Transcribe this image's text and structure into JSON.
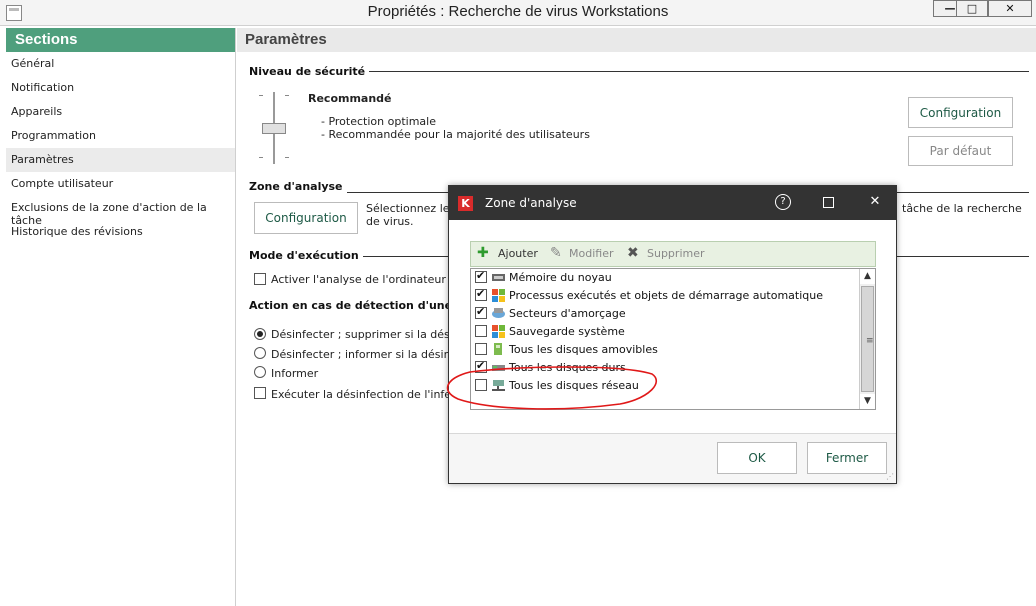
{
  "window": {
    "title": "Propriétés : Recherche de virus Workstations"
  },
  "window_controls": {
    "minimize": "—",
    "maximize": "□",
    "close": "✕"
  },
  "sidebar": {
    "title": "Sections",
    "items": [
      {
        "label": "Général"
      },
      {
        "label": "Notification"
      },
      {
        "label": "Appareils"
      },
      {
        "label": "Programmation"
      },
      {
        "label": "Paramètres",
        "active": true
      },
      {
        "label": "Compte utilisateur"
      },
      {
        "label": "Exclusions de la zone d'action de la tâche"
      },
      {
        "label": "Historique des révisions"
      }
    ]
  },
  "main": {
    "title": "Paramètres",
    "security_level": {
      "title": "Niveau de sécurité",
      "level_name": "Recommandé",
      "line1": "- Protection optimale",
      "line2": "- Recommandée pour la majorité des utilisateurs",
      "configure_label": "Configuration",
      "default_label": "Par défaut"
    },
    "scan_zone": {
      "title": "Zone d'analyse",
      "configure_label": "Configuration",
      "desc_left_1": "Sélectionnez les",
      "desc_left_2": "de virus.",
      "desc_right": "tâche de la recherche"
    },
    "run_mode": {
      "title": "Mode d'exécution",
      "checkbox_label": "Activer l'analyse de l'ordinateur lor"
    },
    "action": {
      "title": "Action en cas de détection d'une m",
      "radio1": "Désinfecter ; supprimer si la désinf",
      "radio2": "Désinfecter ; informer si la désinfec",
      "radio3": "Informer",
      "checkbox": "Exécuter la désinfection de l'infect"
    }
  },
  "dialog": {
    "title": "Zone d'analyse",
    "help_glyph": "?",
    "maximize_glyph": "",
    "close_glyph": "✕",
    "logo_glyph": "K",
    "toolbar": {
      "add": "Ajouter",
      "modify": "Modifier",
      "delete": "Supprimer",
      "add_glyph": "✚",
      "modify_glyph": "✎",
      "delete_glyph": "✖"
    },
    "items": [
      {
        "label": "Mémoire du noyau",
        "checked": true
      },
      {
        "label": "Processus exécutés et objets de démarrage automatique",
        "checked": true
      },
      {
        "label": "Secteurs d'amorçage",
        "checked": true
      },
      {
        "label": "Sauvegarde système",
        "checked": false
      },
      {
        "label": "Tous les disques amovibles",
        "checked": false
      },
      {
        "label": "Tous les disques durs",
        "checked": true
      },
      {
        "label": "Tous les disques réseau",
        "checked": false
      }
    ],
    "scroll": {
      "up": "▲",
      "down": "▼",
      "grip": "≡"
    },
    "ok_label": "OK",
    "close_label": "Fermer",
    "grip_glyph": "⋰"
  },
  "colors": {
    "sidebar_header": "#4f9f7d",
    "dialog_title": "#333333",
    "button_text": "#1e5a46",
    "annotation": "#e01818"
  }
}
